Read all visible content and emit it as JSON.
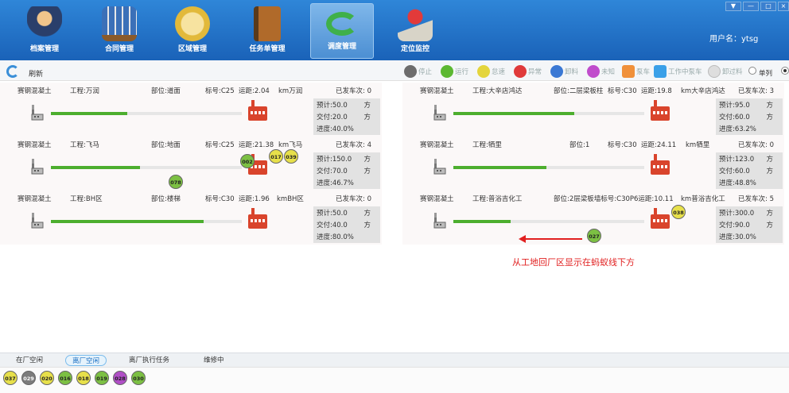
{
  "nav": {
    "items": [
      {
        "label": "档案管理",
        "color": "#3b5fa6"
      },
      {
        "label": "合同管理",
        "color": "#8a6a3a"
      },
      {
        "label": "区域管理",
        "color": "#e8c24a"
      },
      {
        "label": "任务单管理",
        "color": "#9a5a2a"
      },
      {
        "label": "调度管理",
        "color": "#3fb04a"
      },
      {
        "label": "定位监控",
        "color": "#d34a4a"
      }
    ],
    "active_index": 4,
    "user": "用户名：ytsg"
  },
  "toolbar": {
    "refresh_label": "刷新",
    "legend": [
      {
        "label": "停止",
        "color": "#6c6c6c",
        "shape": "dot"
      },
      {
        "label": "运行",
        "color": "#5cb832",
        "shape": "dot"
      },
      {
        "label": "怠速",
        "color": "#e4d53c",
        "shape": "dot"
      },
      {
        "label": "异常",
        "color": "#e03a3a",
        "shape": "dot"
      },
      {
        "label": "卸料",
        "color": "#3a78d4",
        "shape": "dot"
      },
      {
        "label": "未知",
        "color": "#c04ccc",
        "shape": "dot"
      },
      {
        "label": "泵车",
        "color": "#f0903a",
        "shape": "square"
      },
      {
        "label": "工作中泵车",
        "color": "#3aa0e8",
        "shape": "square"
      },
      {
        "label": "卸过料",
        "color": "#dedede",
        "shape": "dot"
      }
    ],
    "single_label": "单列"
  },
  "cards": [
    {
      "company": "赛钢混凝土",
      "project": "工程:万润",
      "part": "部位:道面",
      "grade": "标号:C25",
      "distance": "运距:2.04",
      "dest": "km万润",
      "sent": "已发车次: 0",
      "plan": "预计:50.0",
      "delivered": "交付:20.0",
      "progress": "进度:40.0%",
      "progress_value": 0.4,
      "unit": "方",
      "trucks": []
    },
    {
      "company": "赛钢混凝土",
      "project": "工程:大辛店鸿达",
      "part": "部位:二层梁板柱",
      "grade": "标号:C30",
      "distance": "运距:19.8",
      "dest": "km大辛店鸿达",
      "sent": "已发车次: 3",
      "plan": "预计:95.0",
      "delivered": "交付:60.0",
      "progress": "进度:63.2%",
      "progress_value": 0.632,
      "unit": "方",
      "trucks": []
    },
    {
      "company": "赛钢混凝土",
      "project": "工程:飞马",
      "part": "部位:地面",
      "grade": "标号:C25",
      "distance": "运距:21.38",
      "dest": "km飞马",
      "sent": "已发车次: 4",
      "plan": "预计:150.0",
      "delivered": "交付:70.0",
      "progress": "进度:46.7%",
      "progress_value": 0.467,
      "unit": "方",
      "trucks": [
        {
          "id": "078",
          "color": "green"
        },
        {
          "id": "002",
          "color": "green"
        },
        {
          "id": "017",
          "color": "yellow"
        },
        {
          "id": "039",
          "color": "yellow"
        }
      ]
    },
    {
      "company": "赛钢混凝土",
      "project": "工程:牺里",
      "part": "部位:1",
      "grade": "标号:C30",
      "distance": "运距:24.11",
      "dest": "km牺里",
      "sent": "已发车次: 0",
      "plan": "预计:123.0",
      "delivered": "交付:60.0",
      "progress": "进度:48.8%",
      "progress_value": 0.488,
      "unit": "方",
      "trucks": []
    },
    {
      "company": "赛钢混凝土",
      "project": "工程:BH区",
      "part": "部位:楼梯",
      "grade": "标号:C30",
      "distance": "运距:1.96",
      "dest": "kmBH区",
      "sent": "已发车次: 0",
      "plan": "预计:50.0",
      "delivered": "交付:40.0",
      "progress": "进度:80.0%",
      "progress_value": 0.8,
      "unit": "方",
      "trucks": []
    },
    {
      "company": "赛钢混凝土",
      "project": "工程:普浴吉化工",
      "part": "部位:2层梁板墙标号:C30P6运距:10.11",
      "grade": "",
      "distance": "",
      "dest": "km普浴吉化工",
      "sent": "已发车次: 5",
      "plan": "预计:300.0",
      "delivered": "交付:90.0",
      "progress": "进度:30.0%",
      "progress_value": 0.3,
      "unit": "方",
      "trucks": [
        {
          "id": "038",
          "color": "yellow"
        },
        {
          "id": "027",
          "color": "green"
        }
      ]
    }
  ],
  "annotation": "从工地回厂区显示在蚂蚁线下方",
  "bottom_tabs": [
    {
      "label": "在厂空闲"
    },
    {
      "label": "离厂空闲"
    },
    {
      "label": "离厂执行任务"
    },
    {
      "label": "维修中"
    }
  ],
  "bottom_active": 1,
  "bottom_trucks": [
    {
      "id": "037",
      "color": "yellow"
    },
    {
      "id": "029",
      "color": "gray"
    },
    {
      "id": "020",
      "color": "yellow"
    },
    {
      "id": "016",
      "color": "green"
    },
    {
      "id": "018",
      "color": "yellow"
    },
    {
      "id": "019",
      "color": "green"
    },
    {
      "id": "028",
      "color": "purple"
    },
    {
      "id": "030",
      "color": "green"
    }
  ]
}
